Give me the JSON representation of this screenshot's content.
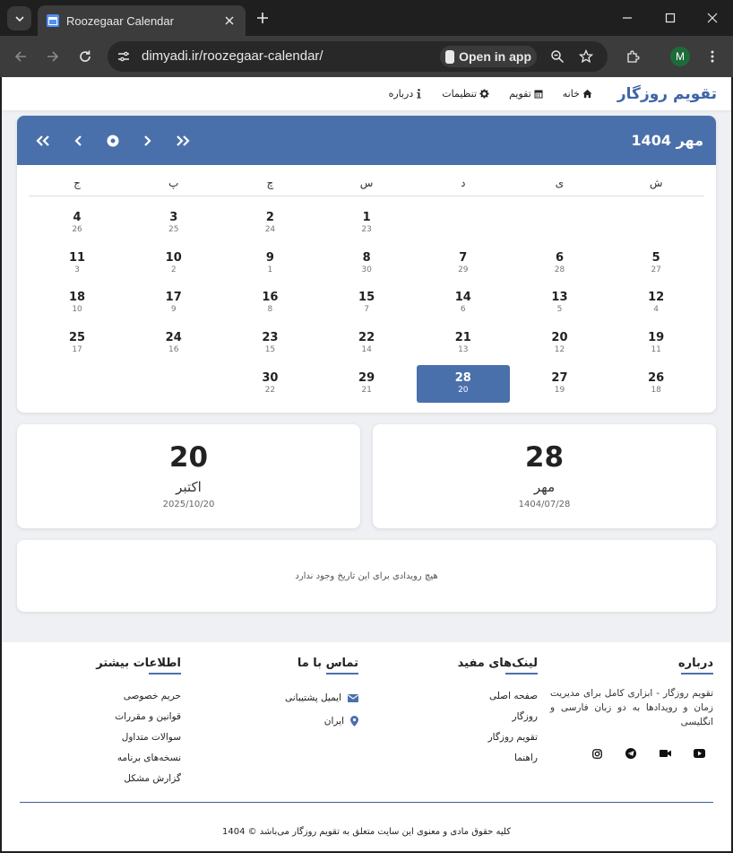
{
  "browser": {
    "tab_title": "Roozegaar Calendar",
    "url": "dimyadi.ir/roozegaar-calendar/",
    "open_in_app": "Open in app",
    "profile_initial": "M"
  },
  "header": {
    "brand": "تقویم روزگار",
    "nav": [
      {
        "label": "خانه",
        "icon": "home-icon"
      },
      {
        "label": "تقویم",
        "icon": "calendar-icon"
      },
      {
        "label": "تنظیمات",
        "icon": "gear-icon"
      },
      {
        "label": "درباره",
        "icon": "info-icon"
      }
    ]
  },
  "calendar": {
    "month_title": "مهر 1404",
    "weekdays": [
      "ش",
      "ی",
      "د",
      "س",
      "چ",
      "پ",
      "ج"
    ],
    "selected_day": "28",
    "accent": "#4a70ab",
    "days": [
      {
        "num": "",
        "sub": ""
      },
      {
        "num": "",
        "sub": ""
      },
      {
        "num": "",
        "sub": ""
      },
      {
        "num": "1",
        "sub": "23"
      },
      {
        "num": "2",
        "sub": "24"
      },
      {
        "num": "3",
        "sub": "25"
      },
      {
        "num": "4",
        "sub": "26"
      },
      {
        "num": "5",
        "sub": "27"
      },
      {
        "num": "6",
        "sub": "28"
      },
      {
        "num": "7",
        "sub": "29"
      },
      {
        "num": "8",
        "sub": "30"
      },
      {
        "num": "9",
        "sub": "1"
      },
      {
        "num": "10",
        "sub": "2"
      },
      {
        "num": "11",
        "sub": "3"
      },
      {
        "num": "12",
        "sub": "4"
      },
      {
        "num": "13",
        "sub": "5"
      },
      {
        "num": "14",
        "sub": "6"
      },
      {
        "num": "15",
        "sub": "7"
      },
      {
        "num": "16",
        "sub": "8"
      },
      {
        "num": "17",
        "sub": "9"
      },
      {
        "num": "18",
        "sub": "10"
      },
      {
        "num": "19",
        "sub": "11"
      },
      {
        "num": "20",
        "sub": "12"
      },
      {
        "num": "21",
        "sub": "13"
      },
      {
        "num": "22",
        "sub": "14"
      },
      {
        "num": "23",
        "sub": "15"
      },
      {
        "num": "24",
        "sub": "16"
      },
      {
        "num": "25",
        "sub": "17"
      },
      {
        "num": "26",
        "sub": "18"
      },
      {
        "num": "27",
        "sub": "19"
      },
      {
        "num": "28",
        "sub": "20"
      },
      {
        "num": "29",
        "sub": "21"
      },
      {
        "num": "30",
        "sub": "22"
      }
    ]
  },
  "persian_date": {
    "day": "28",
    "month": "مهر",
    "full": "1404/07/28"
  },
  "gregorian_date": {
    "day": "20",
    "month": "اکتبر",
    "full": "2025/10/20"
  },
  "events": {
    "empty_text": "هیچ رویدادی برای این تاریخ وجود ندارد"
  },
  "footer": {
    "about": {
      "title": "درباره",
      "text": "تقویم روزگار - ابزاری کامل برای مدیریت زمان و رویدادها به دو زبان فارسی و انگلیسی",
      "socials": [
        "youtube-icon",
        "video-icon",
        "telegram-icon",
        "instagram-icon"
      ]
    },
    "links": {
      "title": "لینک‌های مفید",
      "items": [
        "صفحه اصلی",
        "روزگار",
        "تقویم روزگار",
        "راهنما"
      ]
    },
    "contact": {
      "title": "تماس با ما",
      "email": "ایمیل پشتیبانی",
      "location": "ایران"
    },
    "more": {
      "title": "اطلاعات بیشتر",
      "items": [
        "حریم خصوصی",
        "قوانین و مقررات",
        "سوالات متداول",
        "نسخه‌های برنامه",
        "گزارش مشکل"
      ]
    },
    "copyright": "کلیه حقوق مادی و معنوی این سایت متعلق به تقویم روزگار می‌باشد © 1404"
  }
}
